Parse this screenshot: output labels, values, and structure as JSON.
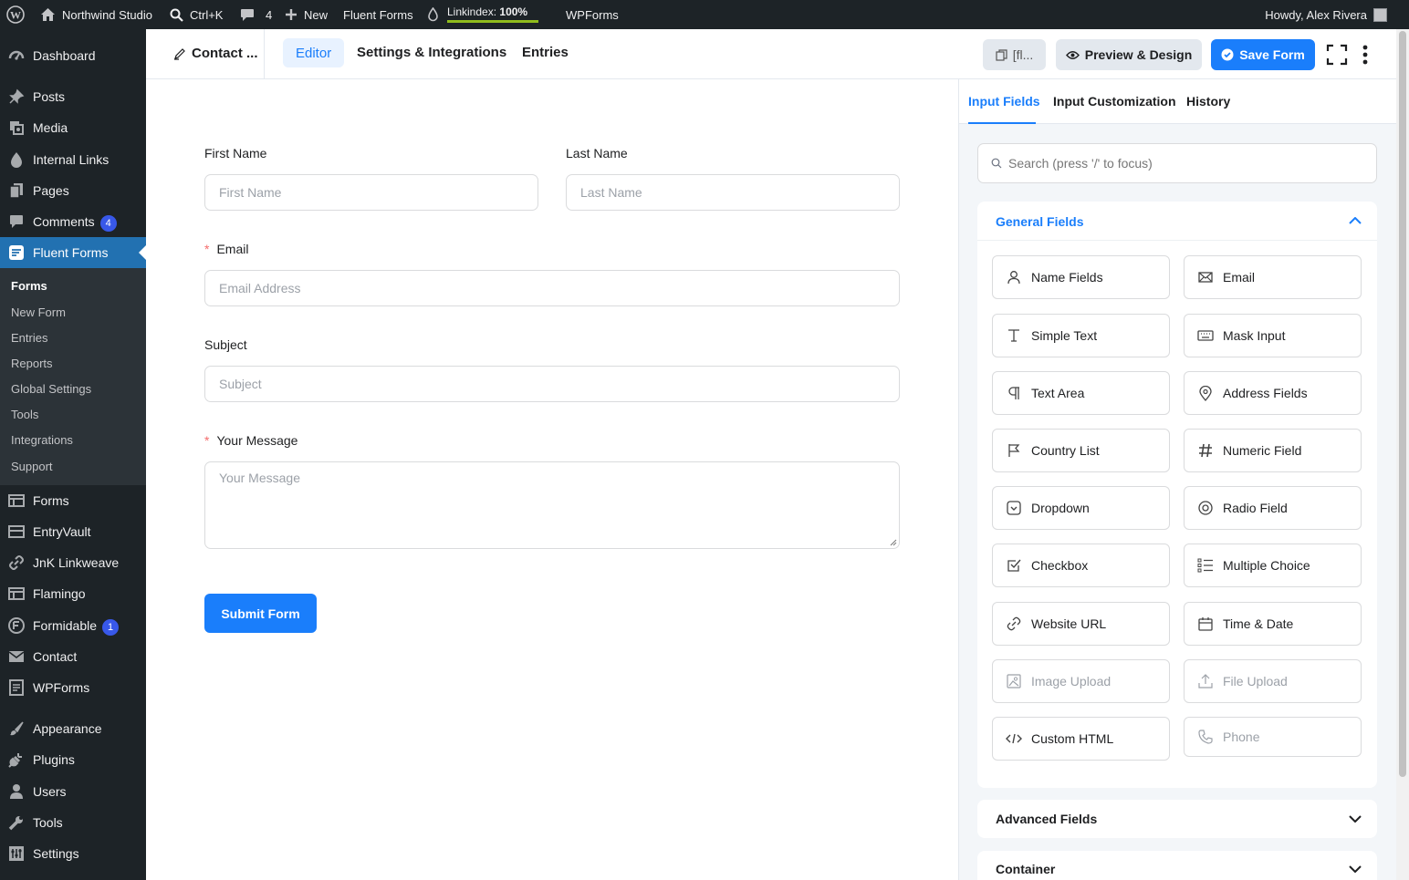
{
  "admin_bar": {
    "site_name": "Northwind Studio",
    "search_shortcut": "Ctrl+K",
    "comments_count": "4",
    "new_label": "New",
    "fluent_forms": "Fluent Forms",
    "linkindex_label": "Linkindex:",
    "linkindex_value": "100%",
    "linkindex_progress": 1.0,
    "wpforms": "WPForms",
    "howdy": "Howdy, Alex Rivera"
  },
  "sidebar": {
    "dashboard": "Dashboard",
    "posts": "Posts",
    "media": "Media",
    "internal_links": "Internal Links",
    "pages": "Pages",
    "comments": "Comments",
    "comments_badge": "4",
    "fluent_forms": "Fluent Forms",
    "submenu": [
      "Forms",
      "New Form",
      "Entries",
      "Reports",
      "Global Settings",
      "Tools",
      "Integrations",
      "Support"
    ],
    "forms": "Forms",
    "entryvault": "EntryVault",
    "jnk": "JnK Linkweave",
    "flamingo": "Flamingo",
    "formidable": "Formidable",
    "formidable_badge": "1",
    "contact": "Contact",
    "wpforms": "WPForms",
    "appearance": "Appearance",
    "plugins": "Plugins",
    "users": "Users",
    "tools": "Tools",
    "settings": "Settings"
  },
  "editor_bar": {
    "form_title": "Contact ...",
    "tab_editor": "Editor",
    "tab_settings": "Settings & Integrations",
    "tab_entries": "Entries",
    "shortcode": "[fl...",
    "preview": "Preview & Design",
    "save": "Save Form"
  },
  "form": {
    "first_name_label": "First Name",
    "first_name_placeholder": "First Name",
    "last_name_label": "Last Name",
    "last_name_placeholder": "Last Name",
    "email_label": "Email",
    "email_placeholder": "Email Address",
    "subject_label": "Subject",
    "subject_placeholder": "Subject",
    "message_label": "Your Message",
    "message_placeholder": "Your Message",
    "required_mark": "*",
    "submit": "Submit Form"
  },
  "panel": {
    "tab_input_fields": "Input Fields",
    "tab_customization": "Input Customization",
    "tab_history": "History",
    "search_placeholder": "Search (press '/' to focus)",
    "general_title": "General Fields",
    "fields": {
      "name_fields": "Name Fields",
      "email": "Email",
      "simple_text": "Simple Text",
      "mask_input": "Mask Input",
      "text_area": "Text Area",
      "address_fields": "Address Fields",
      "country_list": "Country List",
      "numeric_field": "Numeric Field",
      "dropdown": "Dropdown",
      "radio_field": "Radio Field",
      "checkbox": "Checkbox",
      "multiple_choice": "Multiple Choice",
      "website_url": "Website URL",
      "time_date": "Time & Date",
      "image_upload": "Image Upload",
      "file_upload": "File Upload",
      "custom_html": "Custom HTML",
      "phone": "Phone"
    },
    "advanced_title": "Advanced Fields",
    "container_title": "Container"
  },
  "colors": {
    "accent": "#1a7efb",
    "wp_blue": "#2271b1",
    "admin_dark": "#1d2327",
    "required": "#f56c6c"
  }
}
